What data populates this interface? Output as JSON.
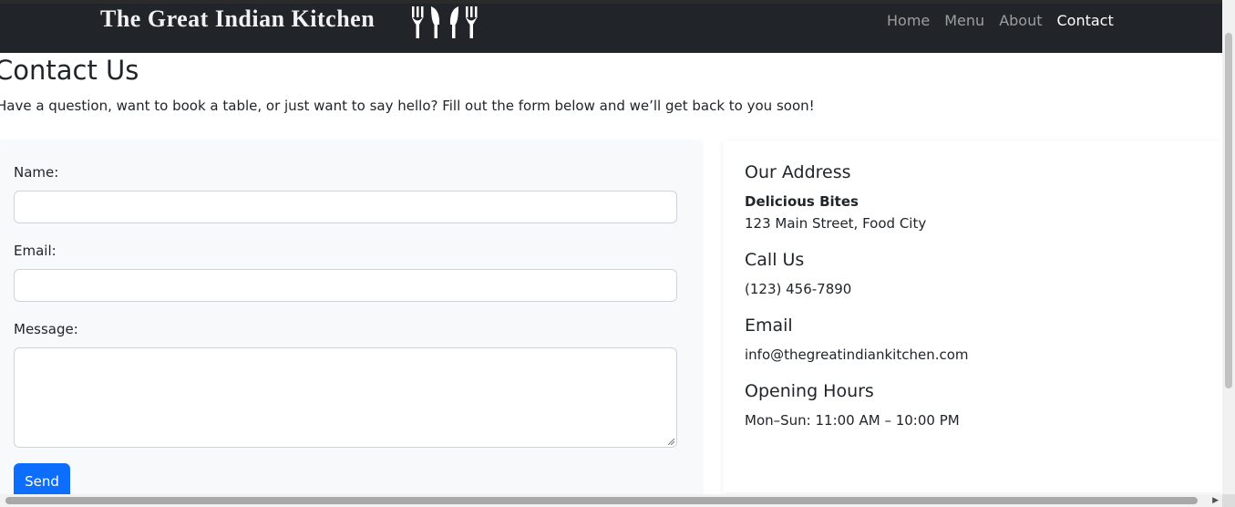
{
  "navbar": {
    "brand": "The Great Indian Kitchen",
    "links": [
      {
        "label": "Home",
        "active": false
      },
      {
        "label": "Menu",
        "active": false
      },
      {
        "label": "About",
        "active": false
      },
      {
        "label": "Contact",
        "active": true
      }
    ]
  },
  "page": {
    "title": "Contact Us",
    "intro": "Have a question, want to book a table, or just want to say hello? Fill out the form below and we’ll get back to you soon!"
  },
  "form": {
    "name_label": "Name:",
    "name_value": "",
    "email_label": "Email:",
    "email_value": "",
    "message_label": "Message:",
    "message_value": "",
    "send_label": "Send"
  },
  "info": {
    "address_heading": "Our Address",
    "business_name": "Delicious Bites",
    "address_line": "123 Main Street, Food City",
    "call_heading": "Call Us",
    "phone": "(123) 456-7890",
    "email_heading": "Email",
    "email": "info@thegreatindiankitchen.com",
    "hours_heading": "Opening Hours",
    "hours": "Mon–Sun: 11:00 AM – 10:00 PM"
  },
  "colors": {
    "navbar_bg": "#212529",
    "primary": "#0d6efd",
    "form_bg": "#f8f9fa"
  },
  "icons": [
    "fork-knife-icon"
  ]
}
